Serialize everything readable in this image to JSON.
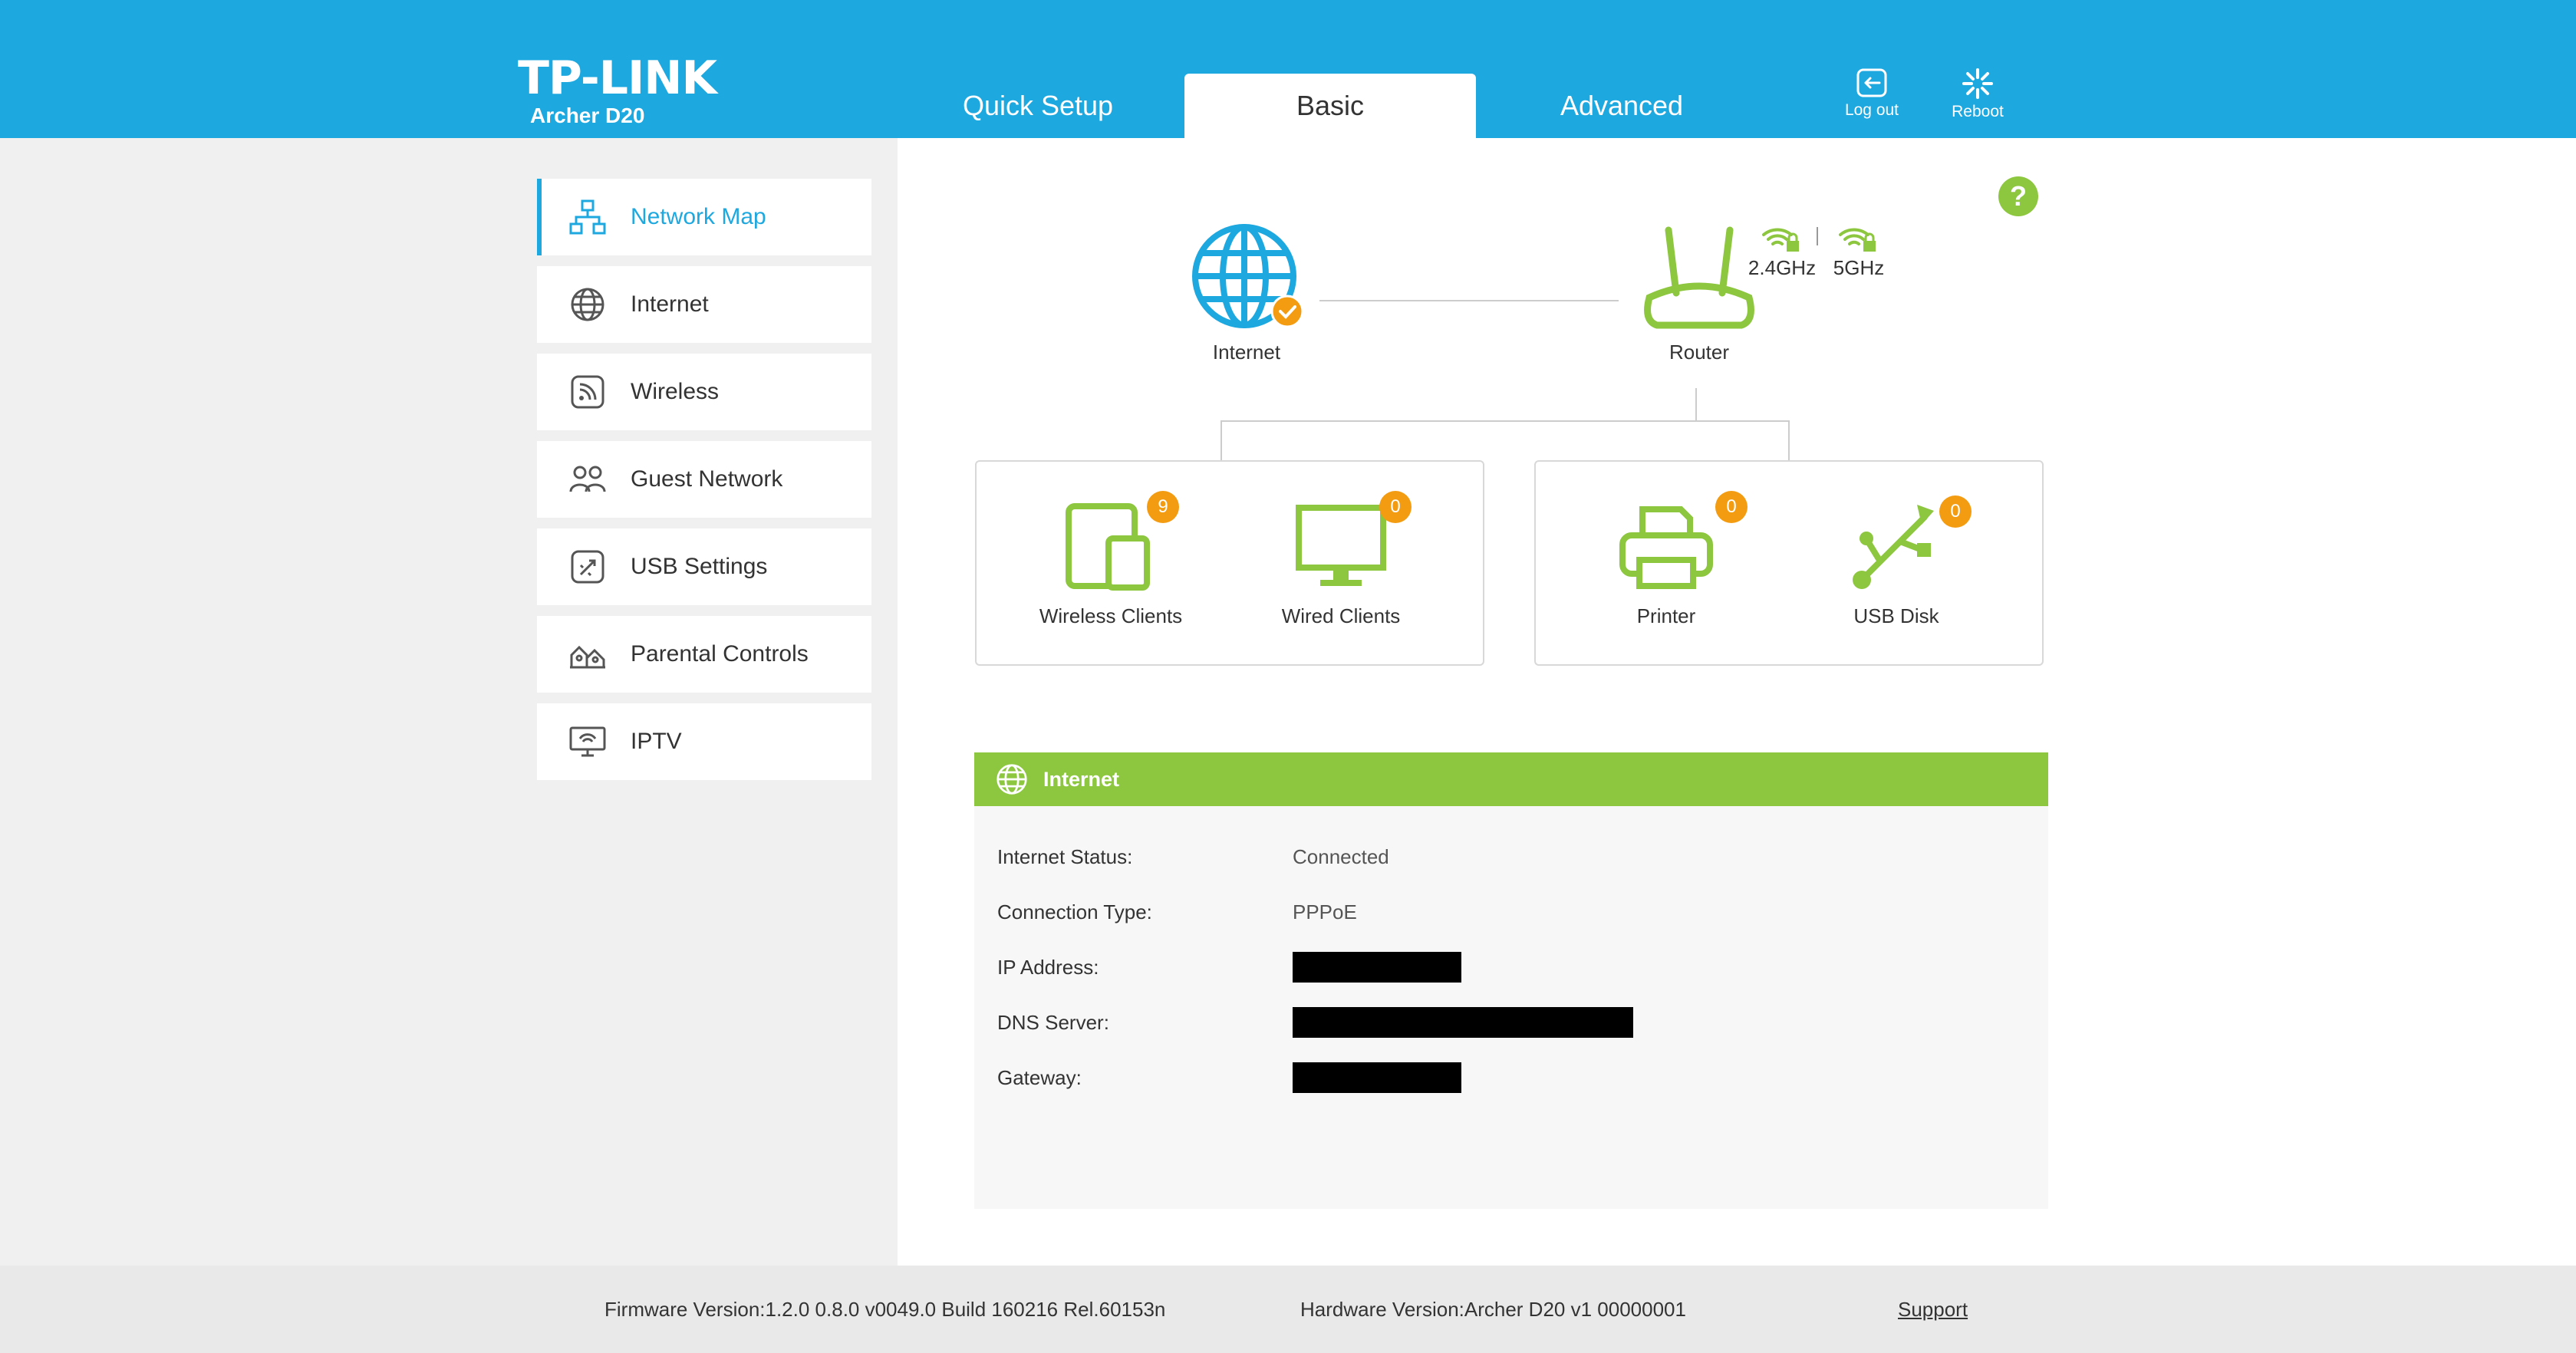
{
  "brand": {
    "logo": "TP-LINK",
    "model": "Archer D20"
  },
  "tabs": [
    {
      "label": "Quick Setup",
      "active": false
    },
    {
      "label": "Basic",
      "active": true
    },
    {
      "label": "Advanced",
      "active": false
    }
  ],
  "header_actions": {
    "logout": "Log out",
    "reboot": "Reboot"
  },
  "sidebar": {
    "items": [
      {
        "label": "Network Map",
        "icon": "network-map-icon",
        "active": true
      },
      {
        "label": "Internet",
        "icon": "globe-icon"
      },
      {
        "label": "Wireless",
        "icon": "wireless-icon"
      },
      {
        "label": "Guest Network",
        "icon": "guest-icon"
      },
      {
        "label": "USB Settings",
        "icon": "usb-settings-icon"
      },
      {
        "label": "Parental Controls",
        "icon": "parental-icon"
      },
      {
        "label": "IPTV",
        "icon": "iptv-icon"
      }
    ]
  },
  "network_map": {
    "help": "?",
    "internet_label": "Internet",
    "router_label": "Router",
    "band_24": "2.4GHz",
    "band_5": "5GHz",
    "devices": {
      "wireless_clients": {
        "label": "Wireless Clients",
        "count": "9"
      },
      "wired_clients": {
        "label": "Wired Clients",
        "count": "0"
      },
      "printer": {
        "label": "Printer",
        "count": "0"
      },
      "usb_disk": {
        "label": "USB Disk",
        "count": "0"
      }
    }
  },
  "internet_panel": {
    "title": "Internet",
    "rows": [
      {
        "key": "Internet Status:",
        "value": "Connected"
      },
      {
        "key": "Connection Type:",
        "value": "PPPoE"
      },
      {
        "key": "IP Address:",
        "value": ""
      },
      {
        "key": "DNS Server:",
        "value": ""
      },
      {
        "key": "Gateway:",
        "value": ""
      }
    ]
  },
  "footer": {
    "firmware": "Firmware Version:1.2.0 0.8.0 v0049.0 Build 160216 Rel.60153n",
    "hardware": "Hardware Version:Archer D20 v1 00000001",
    "support": "Support"
  },
  "colors": {
    "header": "#1ea8e0",
    "accent_green": "#8dc63f",
    "badge_orange": "#f39c12",
    "sidebar_bg": "#f0f0f0"
  }
}
